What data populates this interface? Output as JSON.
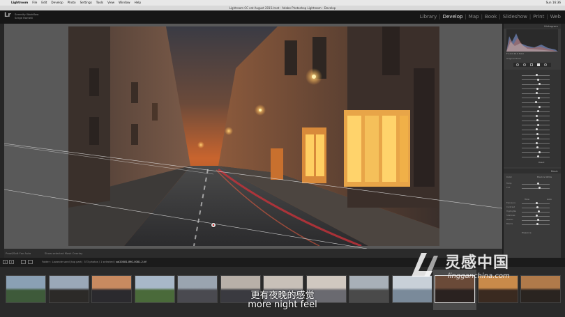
{
  "menubar": {
    "app": "Lightroom",
    "items": [
      "File",
      "Edit",
      "Develop",
      "Photo",
      "Settings",
      "Tools",
      "View",
      "Window",
      "Help"
    ],
    "clock": "Sun 16:36"
  },
  "window_title": "Lightroom CC cat August 2015.lrcat - Adobe Photoshop Lightroom - Develop",
  "identity": {
    "logo": "Lr",
    "line1": "Serenity Workflow",
    "line2": "Serge Ramelli"
  },
  "modules": {
    "items": [
      "Library",
      "Develop",
      "Map",
      "Book",
      "Slideshow",
      "Print",
      "Web"
    ],
    "active": "Develop"
  },
  "toolbar": {
    "soft_proofing_label": "Proof/Soft Fox",
    "soft_proofing_value": "Auto",
    "note": "Show selected Mask Overlay"
  },
  "right_panel": {
    "histogram_title": "Histogram",
    "histogram_readout": "F 10.0   24.0   f/4.0",
    "original_photo_label": "Original Photo",
    "basic_title": "Basic",
    "basic_labels": [
      "Temp",
      "Tint",
      "Exposure",
      "Contrast",
      "Highlights",
      "Shadows",
      "Whites",
      "Blacks",
      "Clarity",
      "Vibrance",
      "Saturation"
    ],
    "color_label": "Color",
    "bw_label": "Black & White",
    "tone_label": "Tone",
    "auto_label": "Auto",
    "presence_label": "Presence",
    "previous_label": "Previous",
    "reset_label": "Reset"
  },
  "filmstrip": {
    "folder_text": "Folder : Lavande sand (top part)",
    "count_text": "373 photos / 1 selected /",
    "selected_file": "sai20081-IMG-0081-2.tif",
    "pages": [
      "1",
      "2"
    ],
    "thumbs": 13,
    "selected_index": 10
  },
  "subtitles": {
    "cn": "更有夜晚的感觉",
    "en": "more night feel"
  },
  "watermark": {
    "cn": "灵感中国",
    "url": "lingganchina.com"
  }
}
